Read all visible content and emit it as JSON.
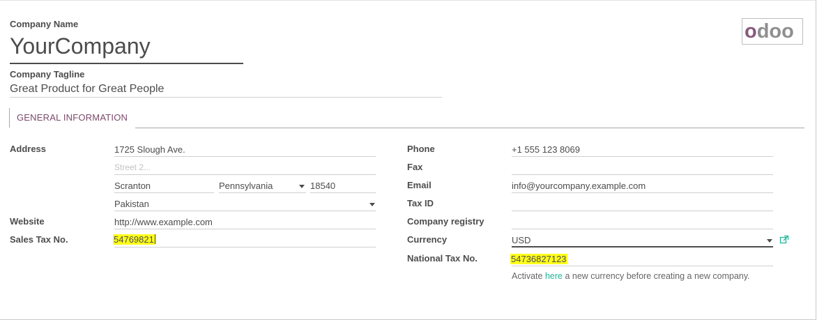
{
  "company": {
    "name_label": "Company Name",
    "name_value": "YourCompany",
    "tagline_label": "Company Tagline",
    "tagline_value": "Great Product for Great People"
  },
  "logo": {
    "text_o1": "o",
    "text_rest": "doo",
    "brand_color": "#875a7b",
    "text_color": "#8f8f8f"
  },
  "tabs": [
    {
      "label": "GENERAL INFORMATION",
      "active": true
    }
  ],
  "left": {
    "address_label": "Address",
    "street": "1725 Slough Ave.",
    "street2_placeholder": "Street 2...",
    "city": "Scranton",
    "state": "Pennsylvania",
    "zip": "18540",
    "country": "Pakistan",
    "website_label": "Website",
    "website": "http://www.example.com",
    "sales_tax_label": "Sales Tax No.",
    "sales_tax": "54769821"
  },
  "right": {
    "phone_label": "Phone",
    "phone": "+1 555 123 8069",
    "fax_label": "Fax",
    "fax": "",
    "email_label": "Email",
    "email": "info@yourcompany.example.com",
    "taxid_label": "Tax ID",
    "taxid": "",
    "registry_label": "Company registry",
    "registry": "",
    "currency_label": "Currency",
    "currency": "USD",
    "national_tax_label": "National Tax No.",
    "national_tax": "54736827123",
    "activate_prefix": "Activate",
    "activate_link": "here",
    "activate_suffix": "a new currency before creating a new company."
  },
  "colors": {
    "highlight": "#ffff1a",
    "link": "#21b799",
    "accent": "#875a7b"
  }
}
